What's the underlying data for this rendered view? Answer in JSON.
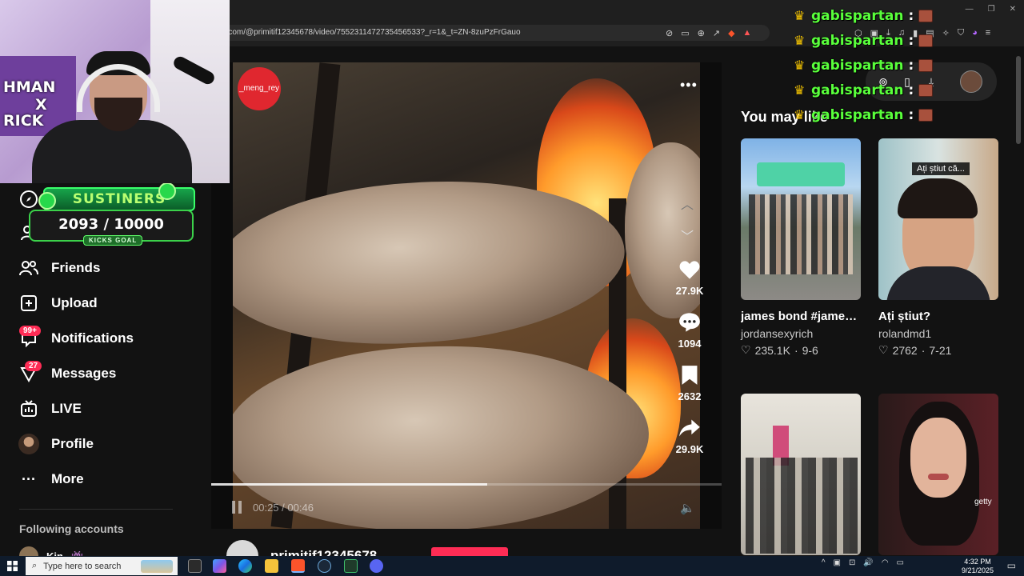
{
  "browser": {
    "url": "ok.com/@primitif12345678/video/7552311472735456533?_r=1&_t=ZN-8zuPzFrGauo"
  },
  "chat": {
    "lines": [
      {
        "user": "gabispartan",
        "sep": ":"
      },
      {
        "user": "gabispartan",
        "sep": ":"
      },
      {
        "user": "gabispartan",
        "sep": ":"
      },
      {
        "user": "gabispartan",
        "sep": ":"
      },
      {
        "user": "gabispartan",
        "sep": ":"
      }
    ]
  },
  "webcam": {
    "poster_line1": "HMAN",
    "poster_line2": "X",
    "poster_line3": "RICK"
  },
  "sustiners": {
    "title": "SUSTINERS",
    "current": "2093",
    "separator": "/",
    "goal": "10000",
    "goal_label": "KICKS GOAL"
  },
  "sidebar": {
    "items": [
      {
        "label": "Friends",
        "icon": "friends-icon"
      },
      {
        "label": "Upload",
        "icon": "upload-icon"
      },
      {
        "label": "Notifications",
        "icon": "notifications-icon",
        "badge": "99+"
      },
      {
        "label": "Messages",
        "icon": "messages-icon",
        "badge": "27"
      },
      {
        "label": "LIVE",
        "icon": "live-icon"
      },
      {
        "label": "Profile",
        "icon": "profile-avatar"
      },
      {
        "label": "More",
        "icon": "more-icon"
      }
    ],
    "following_title": "Following accounts",
    "following": [
      {
        "name": "Kin"
      }
    ]
  },
  "video": {
    "creator_badge": "_meng_rey",
    "time_current": "00:25",
    "time_total": "00:46",
    "progress": 0.54,
    "likes": "27.9K",
    "comments": "1094",
    "saves": "2632",
    "shares": "29.9K",
    "creator_name": "primitif12345678"
  },
  "right": {
    "heading": "You may like",
    "cards": [
      {
        "title": "james bond #jamesbond #danc...",
        "author": "jordansexyrich",
        "likes": "235.1K",
        "date": "9-6"
      },
      {
        "title": "Ați știut?",
        "author": "rolandmd1",
        "likes": "2762",
        "date": "7-21",
        "caption": "Ați știut că..."
      },
      {
        "title": "",
        "author": "",
        "likes": "",
        "date": ""
      },
      {
        "title": "",
        "author": "",
        "likes": "",
        "date": "",
        "caption": "getty"
      }
    ]
  },
  "taskbar": {
    "search_placeholder": "Type here to search",
    "time": "4:32 PM",
    "date": "9/21/2025"
  },
  "colors": {
    "accent": "#fe2c55",
    "chat_user": "#59ff3b",
    "crown": "#f5c400"
  }
}
